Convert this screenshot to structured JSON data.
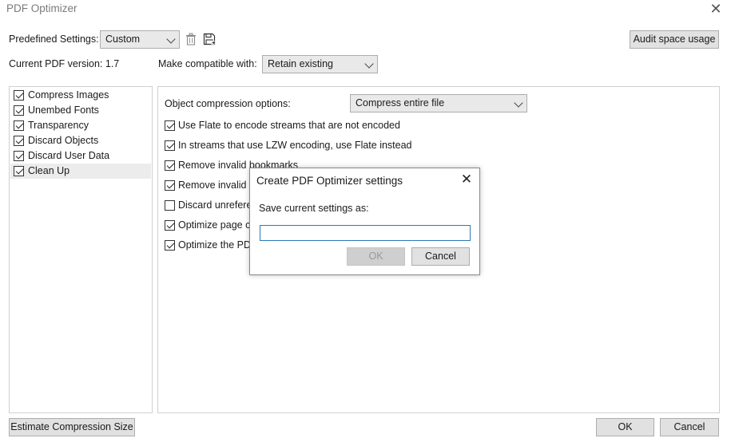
{
  "window": {
    "title": "PDF Optimizer"
  },
  "top": {
    "predefined_label": "Predefined Settings:",
    "predefined_value": "Custom",
    "audit_button": "Audit space usage",
    "version_label": "Current PDF version: 1.7",
    "compat_label": "Make compatible with:",
    "compat_value": "Retain existing"
  },
  "sidebar": {
    "items": [
      {
        "label": "Compress Images",
        "checked": true
      },
      {
        "label": "Unembed Fonts",
        "checked": true
      },
      {
        "label": "Transparency",
        "checked": true
      },
      {
        "label": "Discard Objects",
        "checked": true
      },
      {
        "label": "Discard User Data",
        "checked": true
      },
      {
        "label": "Clean Up",
        "checked": true,
        "selected": true
      }
    ]
  },
  "main": {
    "compression_label": "Object compression options:",
    "compression_value": "Compress entire file",
    "options": [
      {
        "label": "Use Flate to encode streams that are not encoded",
        "checked": true
      },
      {
        "label": "In streams that use LZW encoding, use Flate instead",
        "checked": true
      },
      {
        "label": "Remove invalid bookmarks",
        "checked": true
      },
      {
        "label": "Remove invalid li",
        "checked": true
      },
      {
        "label": "Discard unreferen",
        "checked": false
      },
      {
        "label": "Optimize page co",
        "checked": true
      },
      {
        "label": "Optimize the PDF",
        "checked": true
      }
    ]
  },
  "footer": {
    "estimate_button": "Estimate Compression Size",
    "ok_button": "OK",
    "cancel_button": "Cancel"
  },
  "dialog": {
    "title": "Create PDF Optimizer settings",
    "prompt": "Save current settings as:",
    "input_value": "",
    "ok_button": "OK",
    "cancel_button": "Cancel"
  }
}
